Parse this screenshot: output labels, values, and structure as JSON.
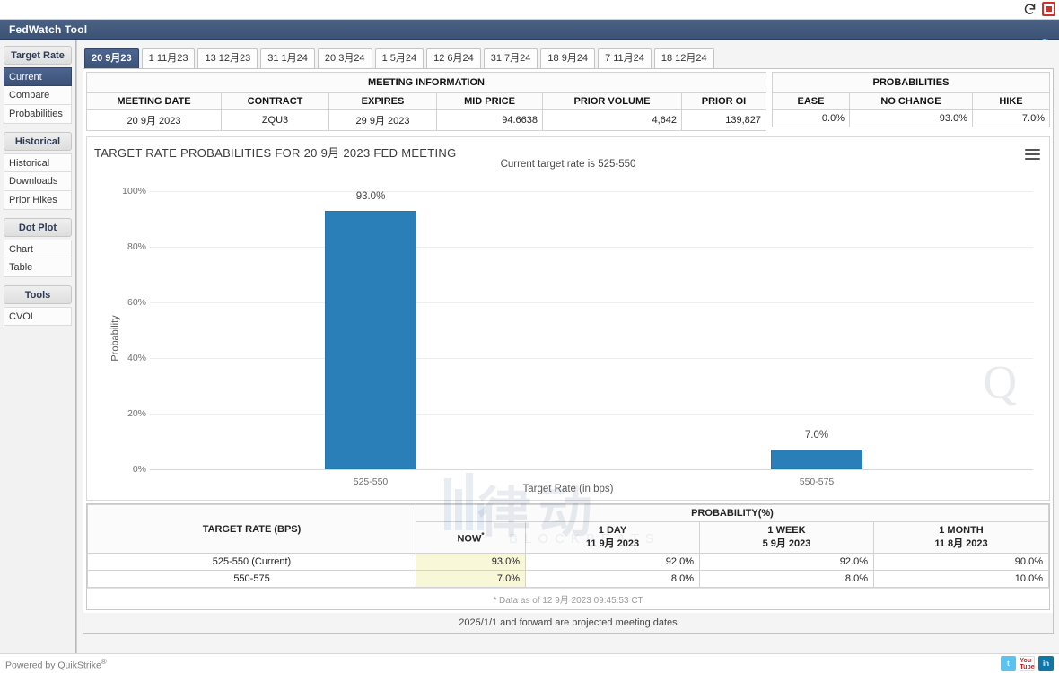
{
  "browser": {
    "reload_icon": "reload-icon",
    "pdf_icon": "pdf-icon"
  },
  "header": {
    "title": "FedWatch Tool",
    "twitter_icon": "twitter-icon"
  },
  "sidebar": {
    "groups": [
      {
        "label": "Target Rate",
        "items": [
          {
            "label": "Current",
            "active": true
          },
          {
            "label": "Compare",
            "active": false
          },
          {
            "label": "Probabilities",
            "active": false
          }
        ]
      },
      {
        "label": "Historical",
        "items": [
          {
            "label": "Historical",
            "active": false
          },
          {
            "label": "Downloads",
            "active": false
          },
          {
            "label": "Prior Hikes",
            "active": false
          }
        ]
      },
      {
        "label": "Dot Plot",
        "items": [
          {
            "label": "Chart",
            "active": false
          },
          {
            "label": "Table",
            "active": false
          }
        ]
      },
      {
        "label": "Tools",
        "items": [
          {
            "label": "CVOL",
            "active": false
          }
        ]
      }
    ]
  },
  "tabs": [
    {
      "label": "20 9月23",
      "active": true
    },
    {
      "label": "1 11月23",
      "active": false
    },
    {
      "label": "13 12月23",
      "active": false
    },
    {
      "label": "31 1月24",
      "active": false
    },
    {
      "label": "20 3月24",
      "active": false
    },
    {
      "label": "1 5月24",
      "active": false
    },
    {
      "label": "12 6月24",
      "active": false
    },
    {
      "label": "31 7月24",
      "active": false
    },
    {
      "label": "18 9月24",
      "active": false
    },
    {
      "label": "7 11月24",
      "active": false
    },
    {
      "label": "18 12月24",
      "active": false
    }
  ],
  "meeting_information": {
    "group_label": "MEETING INFORMATION",
    "headers": [
      "MEETING DATE",
      "CONTRACT",
      "EXPIRES",
      "MID PRICE",
      "PRIOR VOLUME",
      "PRIOR OI"
    ],
    "row": [
      "20 9月 2023",
      "ZQU3",
      "29 9月 2023",
      "94.6638",
      "4,642",
      "139,827"
    ]
  },
  "probabilities_summary": {
    "group_label": "PROBABILITIES",
    "headers": [
      "EASE",
      "NO CHANGE",
      "HIKE"
    ],
    "row": [
      "0.0%",
      "93.0%",
      "7.0%"
    ]
  },
  "chart_data": {
    "type": "bar",
    "title": "TARGET RATE PROBABILITIES FOR 20 9月 2023 FED MEETING",
    "subtitle": "Current target rate is 525-550",
    "categories": [
      "525-550",
      "550-575"
    ],
    "values": [
      93.0,
      7.0
    ],
    "data_labels": [
      "93.0%",
      "7.0%"
    ],
    "xlabel": "Target Rate (in bps)",
    "ylabel": "Probability",
    "ylim": [
      0,
      100
    ],
    "yticks": [
      "0%",
      "20%",
      "40%",
      "60%",
      "80%",
      "100%"
    ],
    "ytick_values": [
      0,
      20,
      40,
      60,
      80,
      100
    ],
    "grid": true,
    "legend": "none",
    "bar_color": "#2a7fb8",
    "menu_icon": "hamburger-menu-icon"
  },
  "watermarks": {
    "chinese": "律动",
    "chinese_sub": "BLOCKBEATS",
    "quikstrike": "Q"
  },
  "probability_table": {
    "target_rate_header": "TARGET RATE (BPS)",
    "probability_header": "PROBABILITY(%)",
    "columns": [
      {
        "label": "NOW",
        "sub": "",
        "star": true
      },
      {
        "label": "1 DAY",
        "sub": "11 9月 2023",
        "star": false
      },
      {
        "label": "1 WEEK",
        "sub": "5 9月 2023",
        "star": false
      },
      {
        "label": "1 MONTH",
        "sub": "11 8月 2023",
        "star": false
      }
    ],
    "rows": [
      {
        "rate": "525-550 (Current)",
        "now": "93.0%",
        "day": "92.0%",
        "week": "92.0%",
        "month": "90.0%"
      },
      {
        "rate": "550-575",
        "now": "7.0%",
        "day": "8.0%",
        "week": "8.0%",
        "month": "10.0%"
      }
    ],
    "footnote": "* Data as of 12 9月 2023 09:45:53 CT",
    "projection_note": "2025/1/1 and forward are projected meeting dates"
  },
  "footer": {
    "powered_by": "Powered by QuikStrike",
    "powered_sup": "®",
    "social": [
      {
        "name": "twitter-icon",
        "label": "t"
      },
      {
        "name": "youtube-icon",
        "label": "You Tube"
      },
      {
        "name": "linkedin-icon",
        "label": "in"
      }
    ]
  }
}
